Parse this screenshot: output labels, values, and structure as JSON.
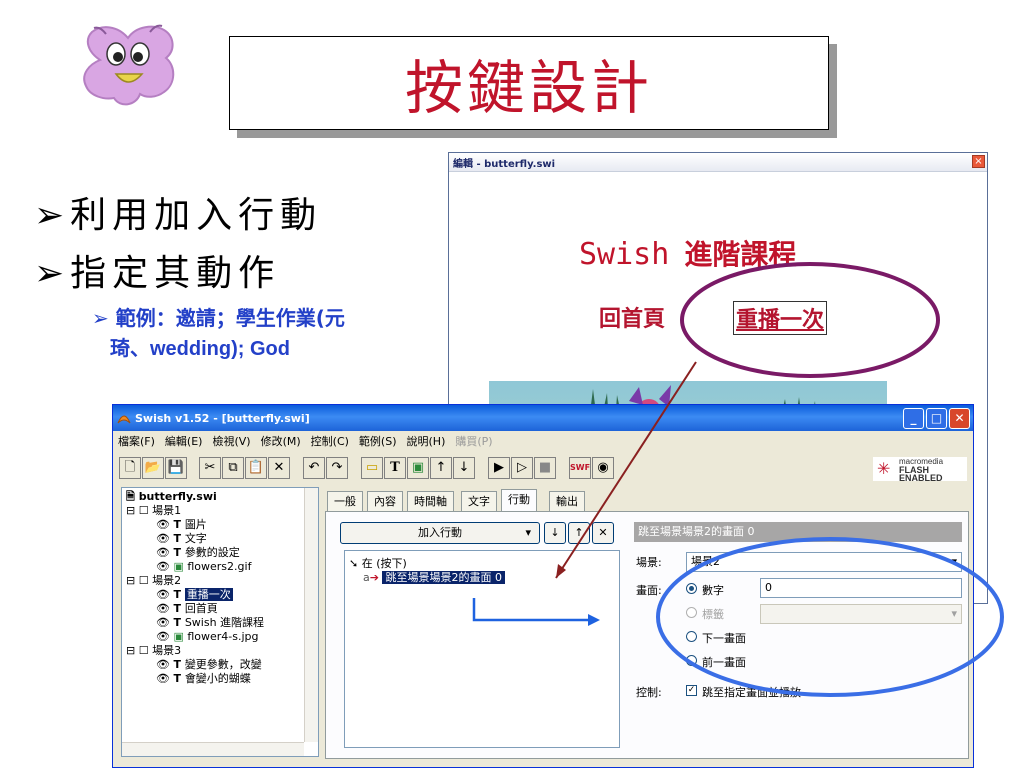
{
  "slide": {
    "title": "按鍵設計",
    "bullets": [
      "利用加入行動",
      "指定其動作"
    ],
    "sub_bullet_line1": "範例：邀請；學生作業(元",
    "sub_bullet_line2": "琦、wedding); God"
  },
  "preview": {
    "window_title": "編輯 - butterfly.swi",
    "close": "×",
    "heading_latin": "Swish",
    "heading_cjk": "進階課程",
    "link_home": "回首頁",
    "link_replay": "重播一次"
  },
  "app": {
    "window_title": "Swish v1.52 - [butterfly.swi]",
    "menu": [
      "檔案(F)",
      "編輯(E)",
      "檢視(V)",
      "修改(M)",
      "控制(C)",
      "範例(S)",
      "說明(H)",
      "購買(P)"
    ],
    "flash_badge": [
      "macromedia",
      "FLASH",
      "ENABLED"
    ],
    "tree": [
      {
        "label": "butterfly.swi",
        "level": 0,
        "icon": "file-icon"
      },
      {
        "label": "場景1",
        "level": 1,
        "icon": "scene-icon"
      },
      {
        "label": "圖片",
        "level": 2,
        "icon": "text-icon"
      },
      {
        "label": "文字",
        "level": 2,
        "icon": "text-icon"
      },
      {
        "label": "參數的設定",
        "level": 2,
        "icon": "text-icon"
      },
      {
        "label": "flowers2.gif",
        "level": 2,
        "icon": "image-icon"
      },
      {
        "label": "場景2",
        "level": 1,
        "icon": "scene-icon"
      },
      {
        "label": "重播一次",
        "level": 2,
        "icon": "text-icon",
        "selected": true
      },
      {
        "label": "回首頁",
        "level": 2,
        "icon": "text-icon"
      },
      {
        "label": "Swish 進階課程",
        "level": 2,
        "icon": "text-icon"
      },
      {
        "label": "flower4-s.jpg",
        "level": 2,
        "icon": "image-icon"
      },
      {
        "label": "場景3",
        "level": 1,
        "icon": "scene-icon"
      },
      {
        "label": "變更參數，改變",
        "level": 2,
        "icon": "text-icon"
      },
      {
        "label": "會變小的蝴蝶",
        "level": 2,
        "icon": "text-icon"
      }
    ],
    "tabs": [
      "一般",
      "內容",
      "時間軸",
      "文字",
      "行動",
      "輸出"
    ],
    "active_tab": "行動",
    "add_action_label": "加入行動",
    "event_label": "在 (按下)",
    "action_item": "跳至場景場景2的畫面 0",
    "action_item_prefix": "a",
    "header_strip": "跳至場景場景2的畫面 0",
    "scene_label": "場景:",
    "scene_value": "場景2",
    "frame_label": "畫面:",
    "frame_options": [
      "數字",
      "標籤",
      "下一畫面",
      "前一畫面"
    ],
    "frame_number": "0",
    "control_label": "控制:",
    "control_option": "跳至指定畫面並播放"
  }
}
